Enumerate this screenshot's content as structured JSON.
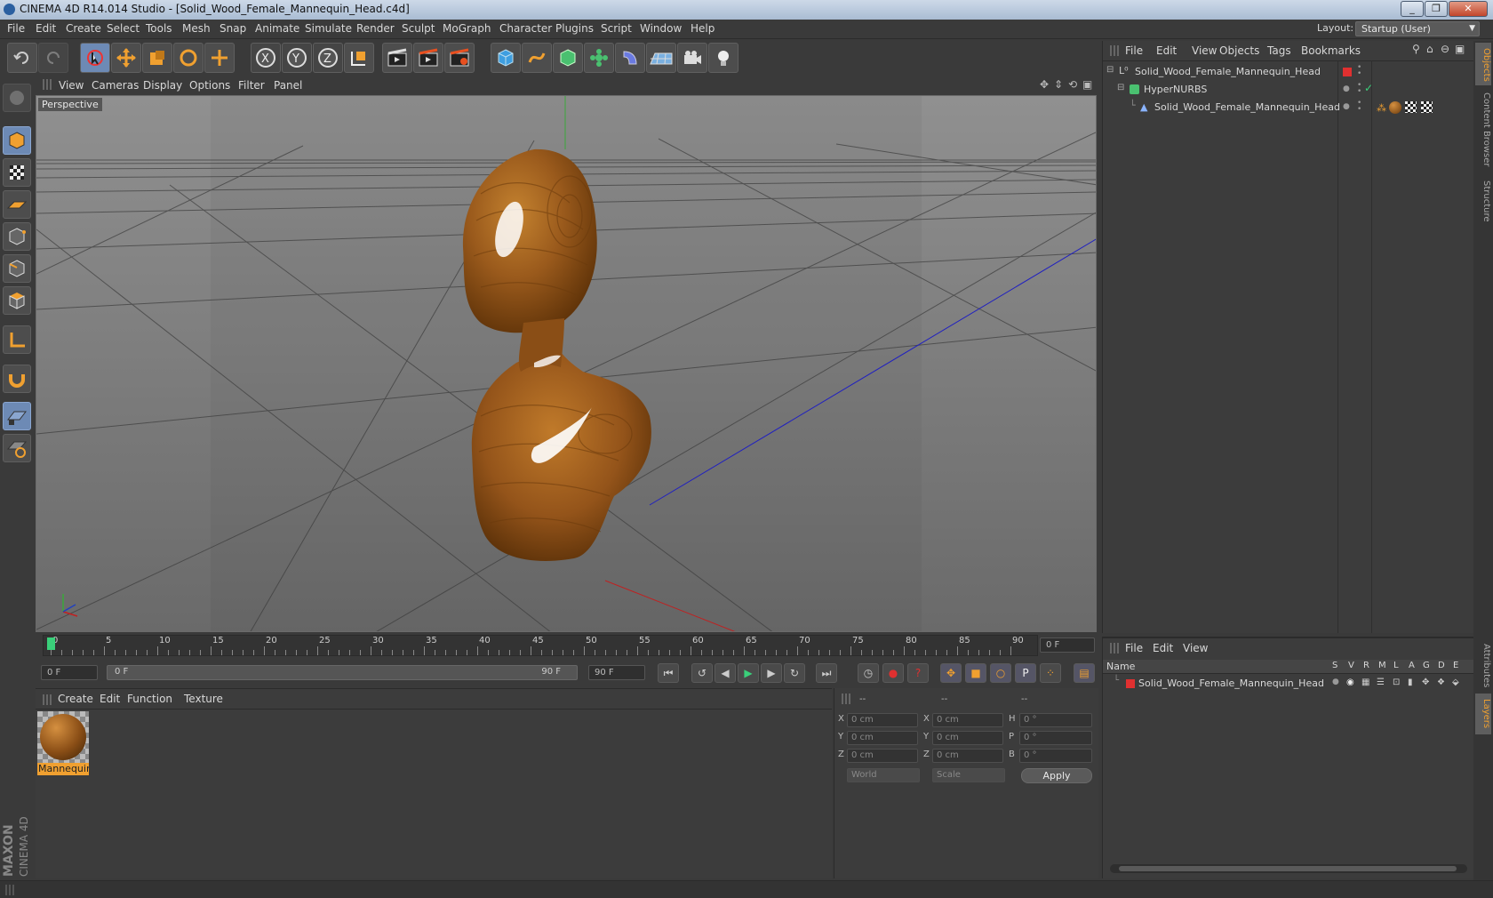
{
  "window": {
    "title": "CINEMA 4D R14.014 Studio - [Solid_Wood_Female_Mannequin_Head.c4d]",
    "controls": [
      "_",
      "❐",
      "✕"
    ]
  },
  "menu": [
    "File",
    "Edit",
    "Create",
    "Select",
    "Tools",
    "Mesh",
    "Snap",
    "Animate",
    "Simulate",
    "Render",
    "Sculpt",
    "MoGraph",
    "Character",
    "Plugins",
    "Script",
    "Window",
    "Help"
  ],
  "layout": {
    "label": "Layout:",
    "value": "Startup (User)"
  },
  "toolbar": {
    "icons": [
      "undo-icon",
      "redo-icon",
      "live-select-icon",
      "move-icon",
      "scale-icon",
      "rotate-icon",
      "recent-tool-icon",
      "x-axis-icon",
      "y-axis-icon",
      "z-axis-icon",
      "world-coord-icon",
      "render-view-icon",
      "render-picture-viewer-icon",
      "render-settings-icon",
      "cube-icon",
      "spline-pen-icon",
      "nurbs-icon",
      "array-icon",
      "deformer-icon",
      "floor-icon",
      "camera-icon",
      "light-icon"
    ]
  },
  "viewport": {
    "menu": [
      "View",
      "Cameras",
      "Display",
      "Options",
      "Filter",
      "Panel"
    ],
    "label": "Perspective"
  },
  "timeline": {
    "ticks": [
      "0",
      "5",
      "10",
      "15",
      "20",
      "25",
      "30",
      "35",
      "40",
      "45",
      "50",
      "55",
      "60",
      "65",
      "70",
      "75",
      "80",
      "85",
      "90"
    ],
    "current_frame": "0 F",
    "start_field": "0 F",
    "range_start": "0 F",
    "range_end": "90 F",
    "end_field": "90 F"
  },
  "materials": {
    "menu": [
      "Create",
      "Edit",
      "Function",
      "Texture"
    ],
    "items": [
      {
        "label": "Mannequin"
      }
    ]
  },
  "coords": {
    "headers": [
      "--",
      "--",
      "--"
    ],
    "rows": [
      {
        "a": "X",
        "av": "0 cm",
        "b": "X",
        "bv": "0 cm",
        "c": "H",
        "cv": "0 °"
      },
      {
        "a": "Y",
        "av": "0 cm",
        "b": "Y",
        "bv": "0 cm",
        "c": "P",
        "cv": "0 °"
      },
      {
        "a": "Z",
        "av": "0 cm",
        "b": "Z",
        "bv": "0 cm",
        "c": "B",
        "cv": "0 °"
      }
    ],
    "mode": "World",
    "size_mode": "Scale",
    "apply": "Apply"
  },
  "objects": {
    "menu": [
      "File",
      "Edit",
      "View",
      "Objects",
      "Tags",
      "Bookmarks"
    ],
    "tree": [
      {
        "name": "Solid_Wood_Female_Mannequin_Head"
      },
      {
        "name": "HyperNURBS"
      },
      {
        "name": "Solid_Wood_Female_Mannequin_Head"
      }
    ]
  },
  "layers": {
    "menu": [
      "File",
      "Edit",
      "View"
    ],
    "columns": [
      "Name",
      "S",
      "V",
      "R",
      "M",
      "L",
      "A",
      "G",
      "D",
      "E"
    ],
    "rows": [
      {
        "name": "Solid_Wood_Female_Mannequin_Head",
        "color": "#e03030"
      }
    ]
  },
  "sidetabs": [
    "Objects",
    "Content Browser",
    "Structure",
    "Attributes",
    "Layers"
  ],
  "brand": {
    "line1": "MAXON",
    "line2": "CINEMA 4D"
  },
  "colors": {
    "accent": "#f0a030",
    "selection": "#6d8ab5",
    "wood": "#9a5a1c"
  }
}
